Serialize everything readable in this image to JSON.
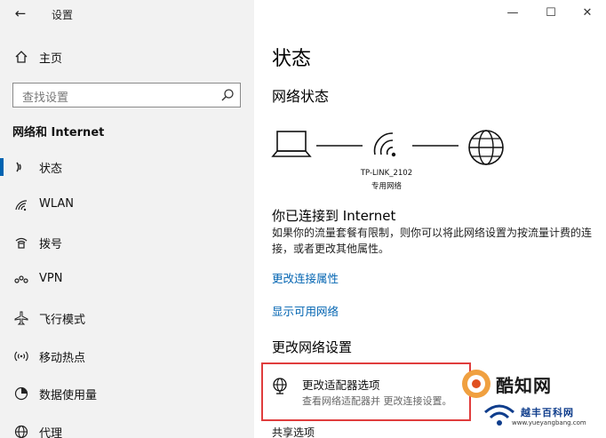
{
  "window": {
    "title": "设置",
    "back_icon": "back-arrow-icon",
    "controls": [
      "minimize",
      "maximize",
      "close"
    ]
  },
  "sidebar": {
    "home_label": "主页",
    "search_placeholder": "查找设置",
    "section_title": "网络和 Internet",
    "items": [
      {
        "label": "状态",
        "icon": "status-icon",
        "selected": true
      },
      {
        "label": "WLAN",
        "icon": "wifi-icon",
        "selected": false
      },
      {
        "label": "拨号",
        "icon": "dialup-icon",
        "selected": false
      },
      {
        "label": "VPN",
        "icon": "vpn-icon",
        "selected": false
      },
      {
        "label": "飞行模式",
        "icon": "airplane-icon",
        "selected": false
      },
      {
        "label": "移动热点",
        "icon": "hotspot-icon",
        "selected": false
      },
      {
        "label": "数据使用量",
        "icon": "data-usage-icon",
        "selected": false
      },
      {
        "label": "代理",
        "icon": "globe-icon",
        "selected": false
      }
    ]
  },
  "main": {
    "page_title": "状态",
    "network_status_title": "网络状态",
    "network_name": "TP-LINK_2102",
    "network_type": "专用网络",
    "connected_title": "你已连接到 Internet",
    "connected_desc": "如果你的流量套餐有限制，则你可以将此网络设置为按流量计费的连接，或者更改其他属性。",
    "link_change_props": "更改连接属性",
    "link_show_networks": "显示可用网络",
    "change_settings_title": "更改网络设置",
    "adapter_title": "更改适配器选项",
    "adapter_desc": "查看网络适配器并 更改连接设置。",
    "next_item": "共享选项"
  },
  "watermark": {
    "brand": "酷知网",
    "brand2": "越丰百科网",
    "url": "www.yueyangbang.com"
  },
  "colors": {
    "accent": "#0063b1",
    "highlight_box": "#e03d3d",
    "sidebar_bg": "#f2f2f2"
  }
}
